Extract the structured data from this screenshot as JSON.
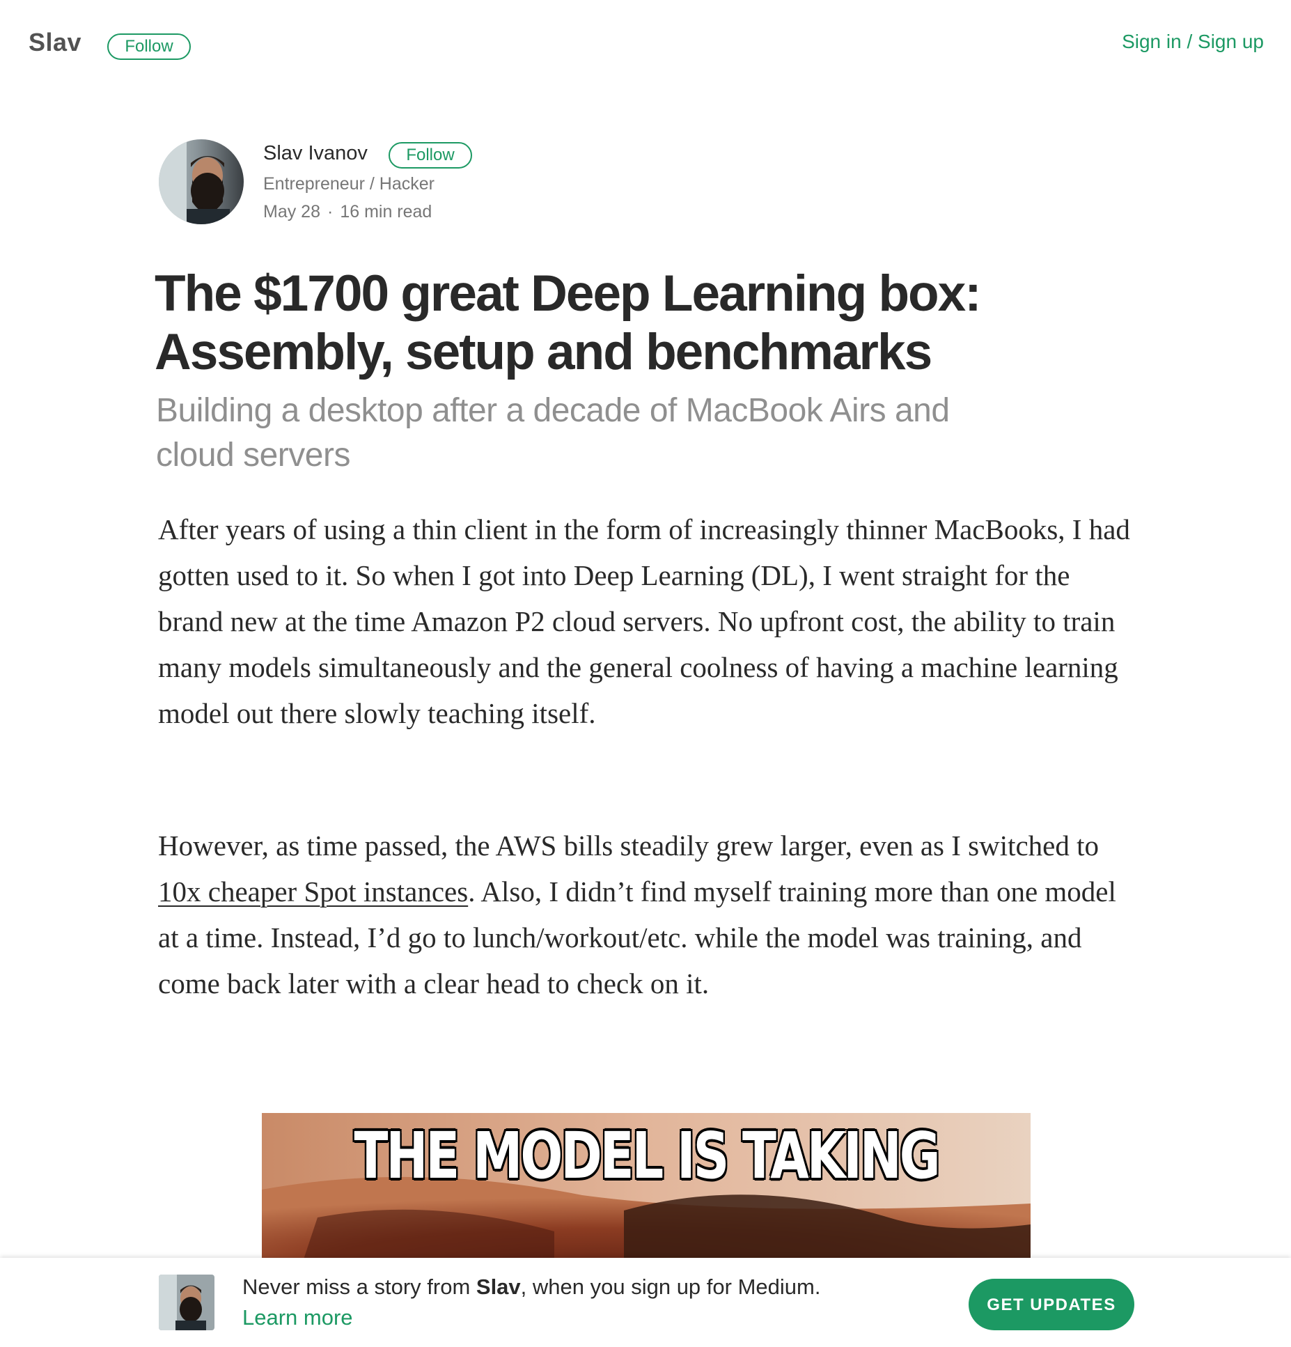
{
  "header": {
    "publication_name": "Slav",
    "follow_label": "Follow",
    "signin_label": "Sign in / Sign up"
  },
  "author": {
    "name": "Slav Ivanov",
    "follow_label": "Follow",
    "bio": "Entrepreneur / Hacker",
    "date": "May 28",
    "separator": "·",
    "read_time": "16 min read"
  },
  "article": {
    "title": "The $1700 great Deep Learning box: Assembly, setup and benchmarks",
    "subtitle": "Building a desktop after a decade of MacBook Airs and cloud servers",
    "paragraphs": [
      {
        "text": "After years of using a thin client in the form of increasingly thinner MacBooks, I had gotten used to it. So when I got into Deep Learning (DL), I went straight for the brand new at the time Amazon P2 cloud servers. No upfront cost, the ability to train many models simultaneously and the general coolness of having a machine learning model out there slowly teaching itself."
      },
      {
        "before_link": "However, as time passed, the AWS bills steadily grew larger, even as I switched to ",
        "link_text": "10x cheaper Spot instances",
        "after_link": ". Also, I didn’t find myself training more than one model at a time. Instead, I’d go to lunch/workout/etc. while the model was training, and come back later with a clear head to check on it."
      }
    ],
    "image_caption": "THE MODEL IS TAKING"
  },
  "bottom_bar": {
    "prefix": "Never miss a story from ",
    "author": "Slav",
    "suffix": ", when you sign up for Medium.",
    "learn_more": "Learn more",
    "cta_label": "GET UPDATES"
  },
  "colors": {
    "accent_green": "#1c9963",
    "text_dark": "rgba(0,0,0,0.84)",
    "text_muted": "rgba(0,0,0,0.54)"
  }
}
